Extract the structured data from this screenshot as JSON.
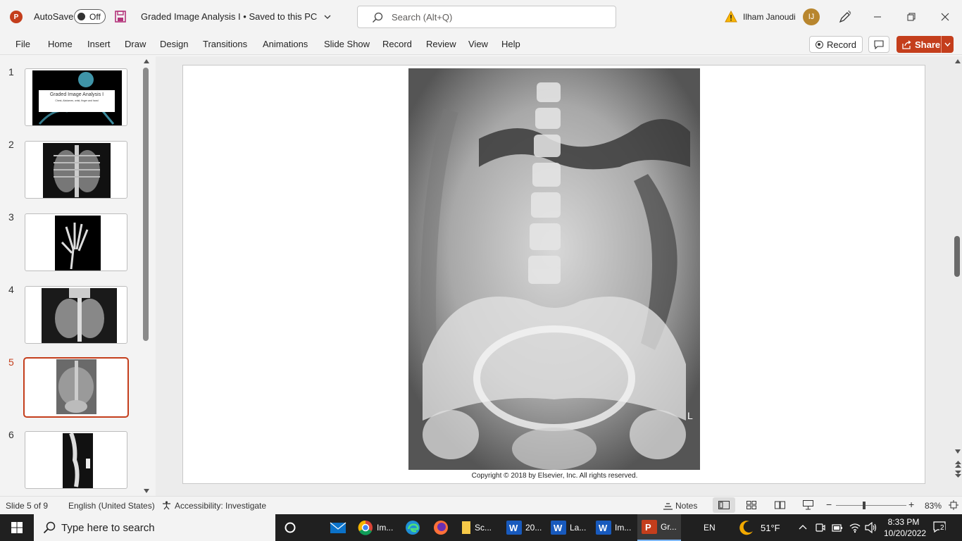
{
  "titlebar": {
    "app_initial": "P",
    "autosave_label": "AutoSave",
    "autosave_state": "Off",
    "doc_title": "Graded Image Analysis I",
    "save_status": "Saved to this PC",
    "search_placeholder": "Search (Alt+Q)",
    "user_name": "Ilham Janoudi",
    "avatar_initial": "IJ",
    "accent": "#c43e1c"
  },
  "ribbon": {
    "tabs": [
      "File",
      "Home",
      "Insert",
      "Draw",
      "Design",
      "Transitions",
      "Animations",
      "Slide Show",
      "Record",
      "Review",
      "View",
      "Help"
    ],
    "record_label": "Record",
    "share_label": "Share"
  },
  "thumbnails": {
    "numbers": [
      "1",
      "2",
      "3",
      "4",
      "5",
      "6"
    ],
    "active": "5",
    "slide1_title": "Graded Image Analysis I",
    "slide1_subtitle": "Chest, Abdomen, wrist, finger and hand"
  },
  "slide": {
    "marker": "L",
    "caption": "Copyright © 2018 by Elsevier, Inc. All rights reserved."
  },
  "statusbar": {
    "slide_info": "Slide 5 of 9",
    "language": "English (United States)",
    "accessibility": "Accessibility: Investigate",
    "notes": "Notes",
    "zoom": "83%"
  },
  "taskbar": {
    "search_placeholder": "Type here to search",
    "apps": [
      "Im...",
      "Sc...",
      "20...",
      "La...",
      "Im...",
      "Gr..."
    ],
    "language": "EN",
    "temperature": "51°F",
    "time": "8:33 PM",
    "date": "10/20/2022",
    "notification_count": "2"
  }
}
